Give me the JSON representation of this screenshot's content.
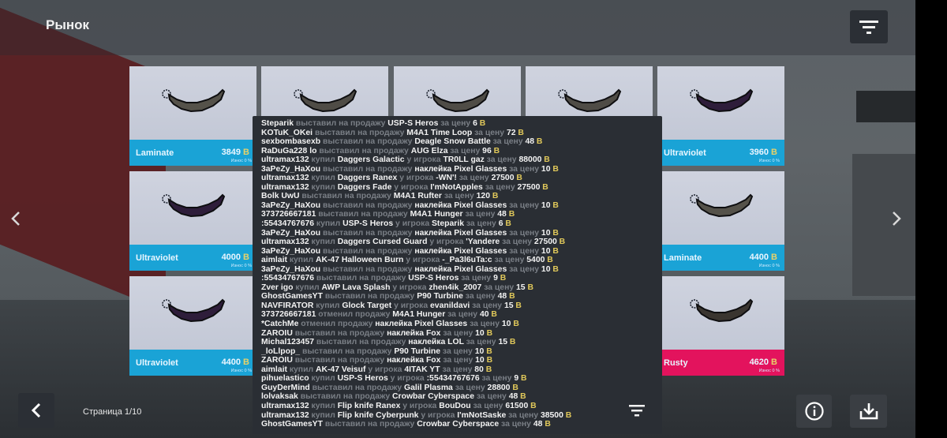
{
  "header": {
    "title": "Рынок"
  },
  "currency_symbol": "B",
  "wear_label": "Износ 0 %",
  "cards": [
    {
      "name": "Laminate",
      "price": "3849",
      "tint": "#55524a",
      "bar": "blue"
    },
    {
      "name": "",
      "price": "",
      "tint": "#4f4c46",
      "bar": "blue"
    },
    {
      "name": "",
      "price": "",
      "tint": "#4f4c46",
      "bar": "blue"
    },
    {
      "name": "",
      "price": "",
      "tint": "#4f4c46",
      "bar": "blue"
    },
    {
      "name": "Ultraviolet",
      "price": "3960",
      "tint": "#2e1d3a",
      "bar": "blue"
    },
    {
      "name": "Ultraviolet",
      "price": "4000",
      "tint": "#2e1d3a",
      "bar": "blue"
    },
    {
      "name": "Laminate",
      "price": "4400",
      "tint": "#55524a",
      "bar": "blue"
    },
    {
      "name": "Ultraviolet",
      "price": "4400",
      "tint": "#2e1d3a",
      "bar": "blue"
    },
    {
      "name": "Rusty",
      "price": "4620",
      "tint": "#3a3530",
      "bar": "rusty"
    }
  ],
  "log": [
    {
      "user": "Steparik",
      "action": "выставил на продажу",
      "item": "USP-S Heros",
      "seller": "",
      "price": "6"
    },
    {
      "user": "KOTuK_OKei",
      "action": "выставил на продажу",
      "item": "M4A1 Time Loop",
      "seller": "",
      "price": "72"
    },
    {
      "user": "sexbombasexb",
      "action": "выставил на продажу",
      "item": "Deagle Snow Battle",
      "seller": "",
      "price": "48"
    },
    {
      "user": "RaDuGa228 lo",
      "action": "выставил на продажу",
      "item": "AUG Elza",
      "seller": "",
      "price": "96"
    },
    {
      "user": "ultramax132",
      "action": "купил",
      "item": "Daggers Galactic",
      "seller": "TR0LL gaz",
      "price": "88000"
    },
    {
      "user": "3aPeZy_HaXou",
      "action": "выставил на продажу",
      "item": "наклейка Pixel Glasses",
      "seller": "",
      "price": "10"
    },
    {
      "user": "ultramax132",
      "action": "купил",
      "item": "Daggers Ranex",
      "seller": "-WN'!",
      "price": "27500"
    },
    {
      "user": "ultramax132",
      "action": "купил",
      "item": "Daggers Fade",
      "seller": "I'mNotApples",
      "price": "27500"
    },
    {
      "user": "Bolk UwU",
      "action": "выставил на продажу",
      "item": "M4A1 Rufter",
      "seller": "",
      "price": "120"
    },
    {
      "user": "3aPeZy_HaXou",
      "action": "выставил на продажу",
      "item": "наклейка Pixel Glasses",
      "seller": "",
      "price": "10"
    },
    {
      "user": "373726667181",
      "action": "выставил на продажу",
      "item": "M4A1 Hunger",
      "seller": "",
      "price": "48"
    },
    {
      "user": ":55434767676",
      "action": "купил",
      "item": "USP-S Heros",
      "seller": "Steparik",
      "price": "6"
    },
    {
      "user": "3aPeZy_HaXou",
      "action": "выставил на продажу",
      "item": "наклейка Pixel Glasses",
      "seller": "",
      "price": "10"
    },
    {
      "user": "ultramax132",
      "action": "купил",
      "item": "Daggers Cursed Guard",
      "seller": "'Yandere",
      "price": "27500"
    },
    {
      "user": "3aPeZy_HaXou",
      "action": "выставил на продажу",
      "item": "наклейка Pixel Glasses",
      "seller": "",
      "price": "10"
    },
    {
      "user": "aimlait",
      "action": "купил",
      "item": "AK-47 Halloween Burn",
      "seller": "-_Pa3l6uTa:c",
      "price": "5400"
    },
    {
      "user": "3aPeZy_HaXou",
      "action": "выставил на продажу",
      "item": "наклейка Pixel Glasses",
      "seller": "",
      "price": "10"
    },
    {
      "user": ":55434767676",
      "action": "выставил на продажу",
      "item": "USP-S Heros",
      "seller": "",
      "price": "9"
    },
    {
      "user": "Zver igo",
      "action": "купил",
      "item": "AWP Lava Splash",
      "seller": "zhen4ik_2007",
      "price": "15"
    },
    {
      "user": "GhostGamesYT",
      "action": "выставил на продажу",
      "item": "P90 Turbine",
      "seller": "",
      "price": "48"
    },
    {
      "user": "NAVFIRATOR",
      "action": "купил",
      "item": "Glock Target",
      "seller": "evanildavi",
      "price": "15"
    },
    {
      "user": "373726667181",
      "action": "отменил продажу",
      "item": "M4A1 Hunger",
      "seller": "",
      "price": "40"
    },
    {
      "user": "*CatchMe",
      "action": "отменил продажу",
      "item": "наклейка Pixel Glasses",
      "seller": "",
      "price": "10"
    },
    {
      "user": "ZAROIU",
      "action": "выставил на продажу",
      "item": "наклейка Fox",
      "seller": "",
      "price": "10"
    },
    {
      "user": "Michal123457",
      "action": "выставил на продажу",
      "item": "наклейка LOL",
      "seller": "",
      "price": "15"
    },
    {
      "user": "_loLlpop_",
      "action": "выставил на продажу",
      "item": "P90 Turbine",
      "seller": "",
      "price": "10"
    },
    {
      "user": "ZAROIU",
      "action": "выставил на продажу",
      "item": "наклейка Fox",
      "seller": "",
      "price": "10"
    },
    {
      "user": "aimlait",
      "action": "купил",
      "item": "AK-47 Veisuf",
      "seller": "4ITAK YT",
      "price": "80"
    },
    {
      "user": "pihuelastico",
      "action": "купил",
      "item": "USP-S Heros",
      "seller": ":55434767676",
      "price": "9"
    },
    {
      "user": "GuyDerMind",
      "action": "выставил на продажу",
      "item": "Galil Plasma",
      "seller": "",
      "price": "28800"
    },
    {
      "user": "lolvaksak",
      "action": "выставил на продажу",
      "item": "Crowbar Cyberspace",
      "seller": "",
      "price": "48"
    },
    {
      "user": "ultramax132",
      "action": "купил",
      "item": "Flip knife Ranex",
      "seller": "BouDou",
      "price": "61500"
    },
    {
      "user": "ultramax132",
      "action": "купил",
      "item": "Flip knife Cyberpunk",
      "seller": "I'mNotSaske",
      "price": "38500"
    },
    {
      "user": "GhostGamesYT",
      "action": "выставил на продажу",
      "item": "Crowbar Cyberspace",
      "seller": "",
      "price": "48"
    }
  ],
  "log_words": {
    "from_player": "у игрока",
    "for_price": "за цену"
  },
  "footer": {
    "page_label": "Страница 1/10"
  },
  "colors": {
    "card_bar": "#1aa3d6",
    "card_bar_rusty": "#e3135d",
    "coin": "#e0c85a",
    "panel": "#2a2e34"
  }
}
